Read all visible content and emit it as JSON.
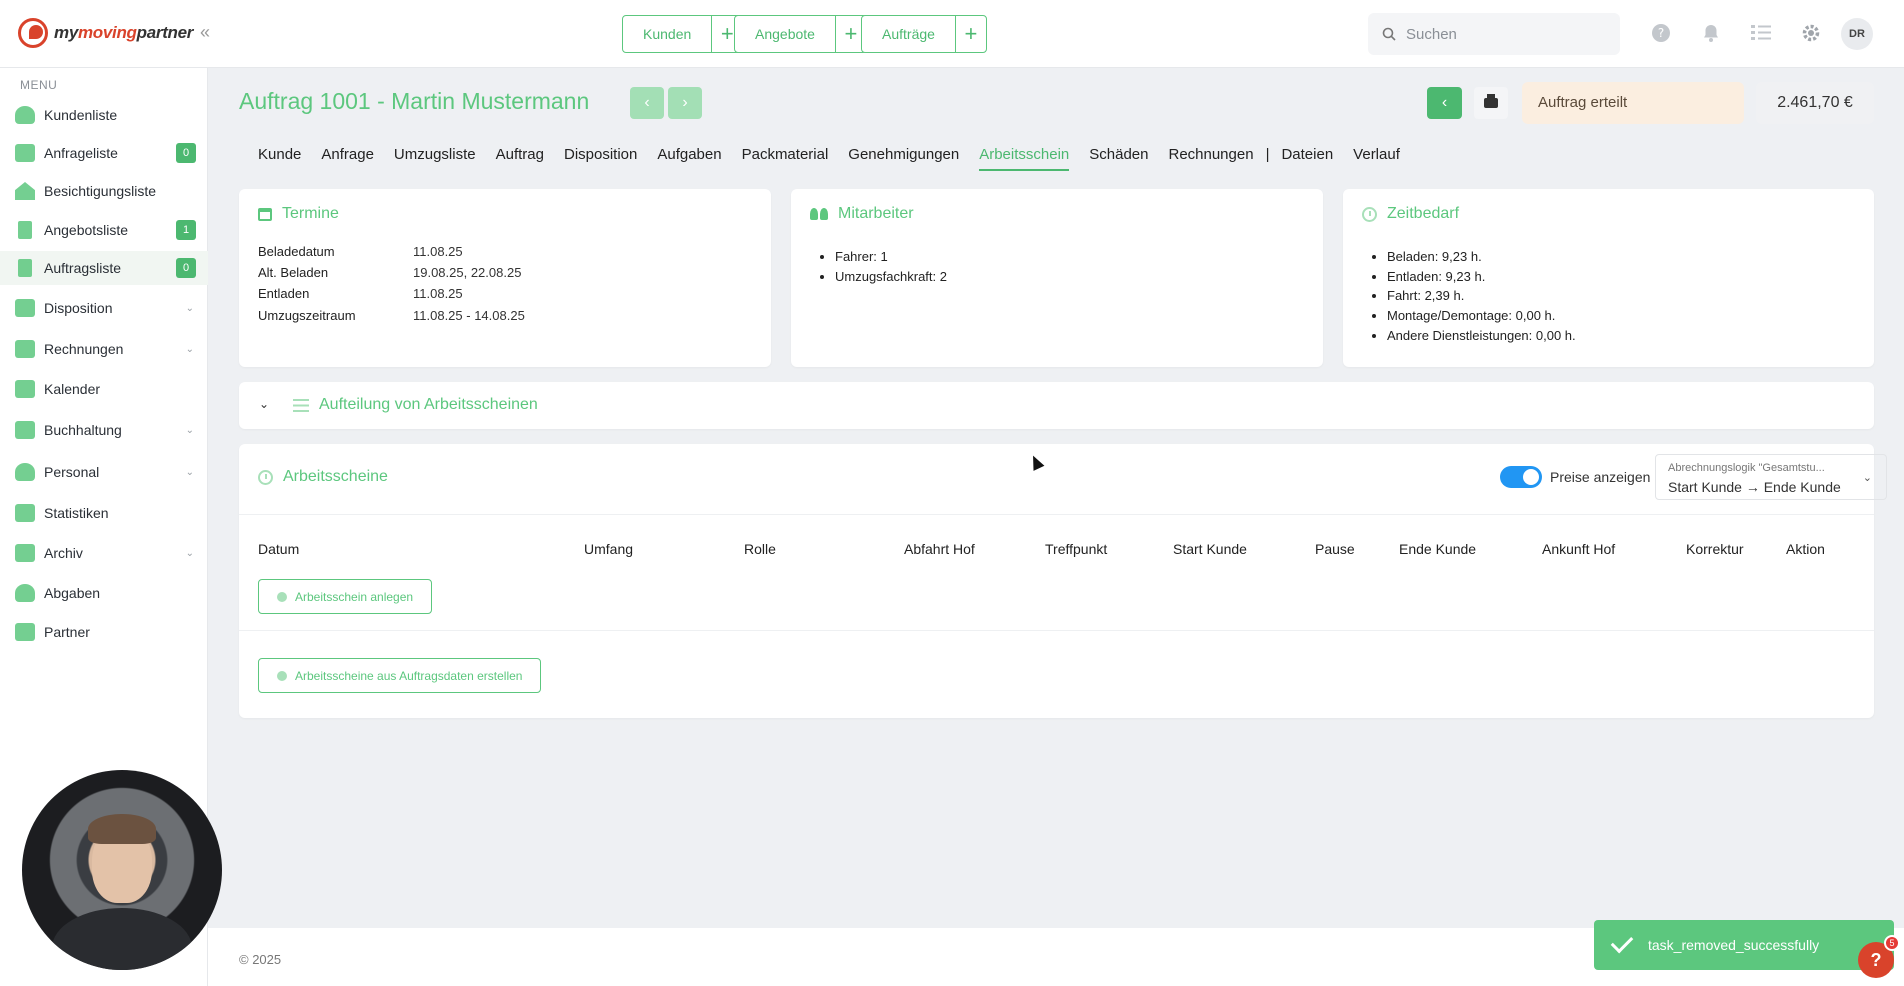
{
  "app": {
    "logo_my": "my",
    "logo_moving": "moving",
    "logo_partner": "partner"
  },
  "topbar": {
    "quick_links": [
      {
        "label": "Kunden"
      },
      {
        "label": "Angebote"
      },
      {
        "label": "Aufträge"
      }
    ],
    "plus_glyph": "+",
    "collapse_glyph": "«",
    "search_placeholder": "Suchen",
    "avatar_initials": "DR",
    "icons": [
      "help-icon",
      "bell-icon",
      "checklist-icon",
      "gear-icon"
    ]
  },
  "sidebar": {
    "menu_heading": "MENU",
    "items": [
      {
        "label": "Kundenliste",
        "badge": "",
        "chevron": ""
      },
      {
        "label": "Anfrageliste",
        "badge": "0",
        "chevron": ""
      },
      {
        "label": "Besichtigungsliste",
        "badge": "",
        "chevron": ""
      },
      {
        "label": "Angebotsliste",
        "badge": "1",
        "chevron": ""
      },
      {
        "label": "Auftragsliste",
        "badge": "0",
        "chevron": ""
      },
      {
        "label": "Disposition",
        "badge": "",
        "chevron": "⌄"
      },
      {
        "label": "Rechnungen",
        "badge": "",
        "chevron": "⌄"
      },
      {
        "label": "Kalender",
        "badge": "",
        "chevron": ""
      },
      {
        "label": "Buchhaltung",
        "badge": "",
        "chevron": "⌄"
      },
      {
        "label": "Personal",
        "badge": "",
        "chevron": "⌄"
      },
      {
        "label": "Statistiken",
        "badge": "",
        "chevron": ""
      },
      {
        "label": "Archiv",
        "badge": "",
        "chevron": "⌄"
      },
      {
        "label": "Abgaben",
        "badge": "",
        "chevron": ""
      },
      {
        "label": "Partner",
        "badge": "",
        "chevron": ""
      }
    ]
  },
  "header": {
    "title": "Auftrag 1001 - Martin Mustermann",
    "prev_glyph": "‹",
    "next_glyph": "›",
    "back_glyph": "‹",
    "status": "Auftrag erteilt",
    "price": "2.461,70 €"
  },
  "tabs": [
    {
      "label": "Kunde"
    },
    {
      "label": "Anfrage"
    },
    {
      "label": "Umzugsliste"
    },
    {
      "label": "Auftrag"
    },
    {
      "label": "Disposition"
    },
    {
      "label": "Aufgaben"
    },
    {
      "label": "Packmaterial"
    },
    {
      "label": "Genehmigungen"
    },
    {
      "label": "Arbeitsschein"
    },
    {
      "label": "Schäden"
    },
    {
      "label": "Rechnungen"
    },
    {
      "label": "Dateien"
    },
    {
      "label": "Verlauf"
    }
  ],
  "tab_separator": "|",
  "termine": {
    "title": "Termine",
    "rows": [
      {
        "key": "Beladedatum",
        "value": "11.08.25"
      },
      {
        "key": "Alt. Beladen",
        "value": "19.08.25, 22.08.25"
      },
      {
        "key": "Entladen",
        "value": "11.08.25"
      },
      {
        "key": "Umzugszeitraum",
        "value": "11.08.25 - 14.08.25"
      }
    ]
  },
  "mitarbeiter": {
    "title": "Mitarbeiter",
    "items": [
      "Fahrer: 1",
      "Umzugsfachkraft: 2"
    ]
  },
  "zeitbedarf": {
    "title": "Zeitbedarf",
    "items": [
      "Beladen: 9,23 h.",
      "Entladen: 9,23 h.",
      "Fahrt: 2,39 h.",
      "Montage/Demontage: 0,00 h.",
      "Andere Dienstleistungen: 0,00 h."
    ]
  },
  "aufteilung": {
    "title": "Aufteilung von Arbeitsscheinen",
    "chevron": "⌄"
  },
  "arbeitsscheine": {
    "title": "Arbeitsscheine",
    "toggle_label": "Preise anzeigen",
    "select_label": "Abrechnungslogik \"Gesamtstu...",
    "select_value": "Start Kunde → Ende Kunde",
    "select_chevron": "⌄",
    "columns": [
      "Datum",
      "Umfang",
      "Rolle",
      "Abfahrt Hof",
      "Treffpunkt",
      "Start Kunde",
      "Pause",
      "Ende Kunde",
      "Ankunft Hof",
      "Korrektur",
      "Aktion"
    ],
    "create_button": "Arbeitsschein anlegen",
    "generate_button": "Arbeitsscheine aus Auftragsdaten erstellen"
  },
  "footer": {
    "copyright": "© 2025"
  },
  "toast": {
    "message": "task_removed_successfully"
  },
  "help": {
    "glyph": "?",
    "badge": "5"
  },
  "colors": {
    "accent": "#5cc77e",
    "accent_dark": "#4cb870",
    "brand_red": "#d9432b",
    "toggle_blue": "#2196f3",
    "status_bg": "#fbeee0"
  }
}
